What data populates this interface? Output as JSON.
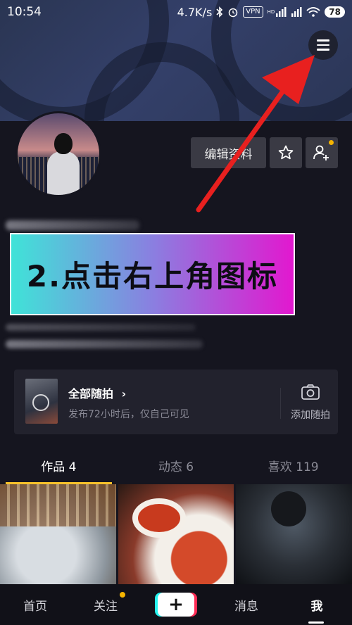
{
  "status_bar": {
    "time": "10:54",
    "network_speed": "4.7K/s",
    "vpn": "VPN",
    "signal_label": "HD",
    "battery": "78"
  },
  "profile": {
    "edit_label": "编辑资料"
  },
  "instruction": {
    "text": "2.点击右上角图标"
  },
  "snaps": {
    "title": "全部随拍",
    "subtitle": "发布72小时后，仅自己可见",
    "add_label": "添加随拍"
  },
  "tabs": [
    {
      "label": "作品 4",
      "active": true
    },
    {
      "label": "动态 6",
      "active": false
    },
    {
      "label": "喜欢 119",
      "active": false
    }
  ],
  "bottom_nav": [
    {
      "label": "首页"
    },
    {
      "label": "关注",
      "badge": true
    },
    {
      "label": "+"
    },
    {
      "label": "消息"
    },
    {
      "label": "我",
      "active": true
    }
  ],
  "colors": {
    "accent_yellow": "#f7c22b",
    "arrow_red": "#e8201f",
    "instruction_gradient_start": "#3fe3d8",
    "instruction_gradient_end": "#e218cf"
  }
}
